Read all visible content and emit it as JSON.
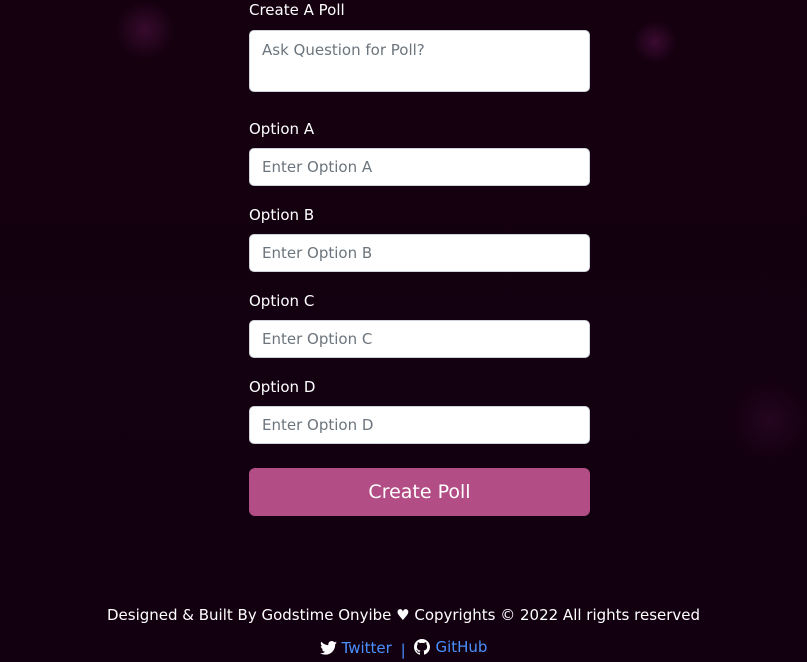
{
  "form": {
    "title": "Create A Poll",
    "question_placeholder": "Ask Question for Poll?",
    "options": [
      {
        "label": "Option A",
        "placeholder": "Enter Option A"
      },
      {
        "label": "Option B",
        "placeholder": "Enter Option B"
      },
      {
        "label": "Option C",
        "placeholder": "Enter Option C"
      },
      {
        "label": "Option D",
        "placeholder": "Enter Option D"
      }
    ],
    "submit_label": "Create Poll"
  },
  "footer": {
    "credit": "Designed & Built By Godstime Onyibe ♥ Copyrights © 2022 All rights reserved",
    "twitter_label": "Twitter",
    "separator": "|",
    "github_label": "GitHub"
  },
  "colors": {
    "background": "#12000f",
    "button": "#b34d85",
    "link": "#4a90ff"
  },
  "icons": {
    "twitter": "twitter-icon",
    "github": "github-icon"
  }
}
